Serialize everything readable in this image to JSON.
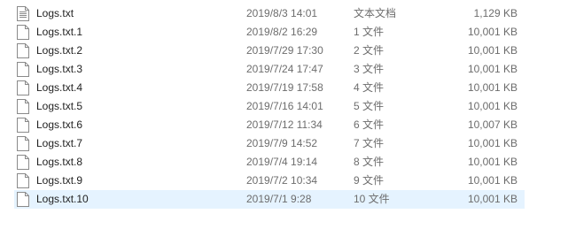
{
  "files": [
    {
      "name": "Logs.txt",
      "date": "2019/8/3 14:01",
      "type": "文本文档",
      "size": "1,129 KB",
      "icon": "text-document-icon"
    },
    {
      "name": "Logs.txt.1",
      "date": "2019/8/2 16:29",
      "type": "1 文件",
      "size": "10,001 KB",
      "icon": "blank-file-icon"
    },
    {
      "name": "Logs.txt.2",
      "date": "2019/7/29 17:30",
      "type": "2 文件",
      "size": "10,001 KB",
      "icon": "blank-file-icon"
    },
    {
      "name": "Logs.txt.3",
      "date": "2019/7/24 17:47",
      "type": "3 文件",
      "size": "10,001 KB",
      "icon": "blank-file-icon"
    },
    {
      "name": "Logs.txt.4",
      "date": "2019/7/19 17:58",
      "type": "4 文件",
      "size": "10,001 KB",
      "icon": "blank-file-icon"
    },
    {
      "name": "Logs.txt.5",
      "date": "2019/7/16 14:01",
      "type": "5 文件",
      "size": "10,001 KB",
      "icon": "blank-file-icon"
    },
    {
      "name": "Logs.txt.6",
      "date": "2019/7/12 11:34",
      "type": "6 文件",
      "size": "10,007 KB",
      "icon": "blank-file-icon"
    },
    {
      "name": "Logs.txt.7",
      "date": "2019/7/9 14:52",
      "type": "7 文件",
      "size": "10,001 KB",
      "icon": "blank-file-icon"
    },
    {
      "name": "Logs.txt.8",
      "date": "2019/7/4 19:14",
      "type": "8 文件",
      "size": "10,001 KB",
      "icon": "blank-file-icon"
    },
    {
      "name": "Logs.txt.9",
      "date": "2019/7/2 10:34",
      "type": "9 文件",
      "size": "10,001 KB",
      "icon": "blank-file-icon"
    },
    {
      "name": "Logs.txt.10",
      "date": "2019/7/1 9:28",
      "type": "10 文件",
      "size": "10,001 KB",
      "icon": "blank-file-icon",
      "selected": true
    }
  ],
  "colors": {
    "selection_background": "#e5f3ff",
    "secondary_text": "#6d6d6d"
  }
}
